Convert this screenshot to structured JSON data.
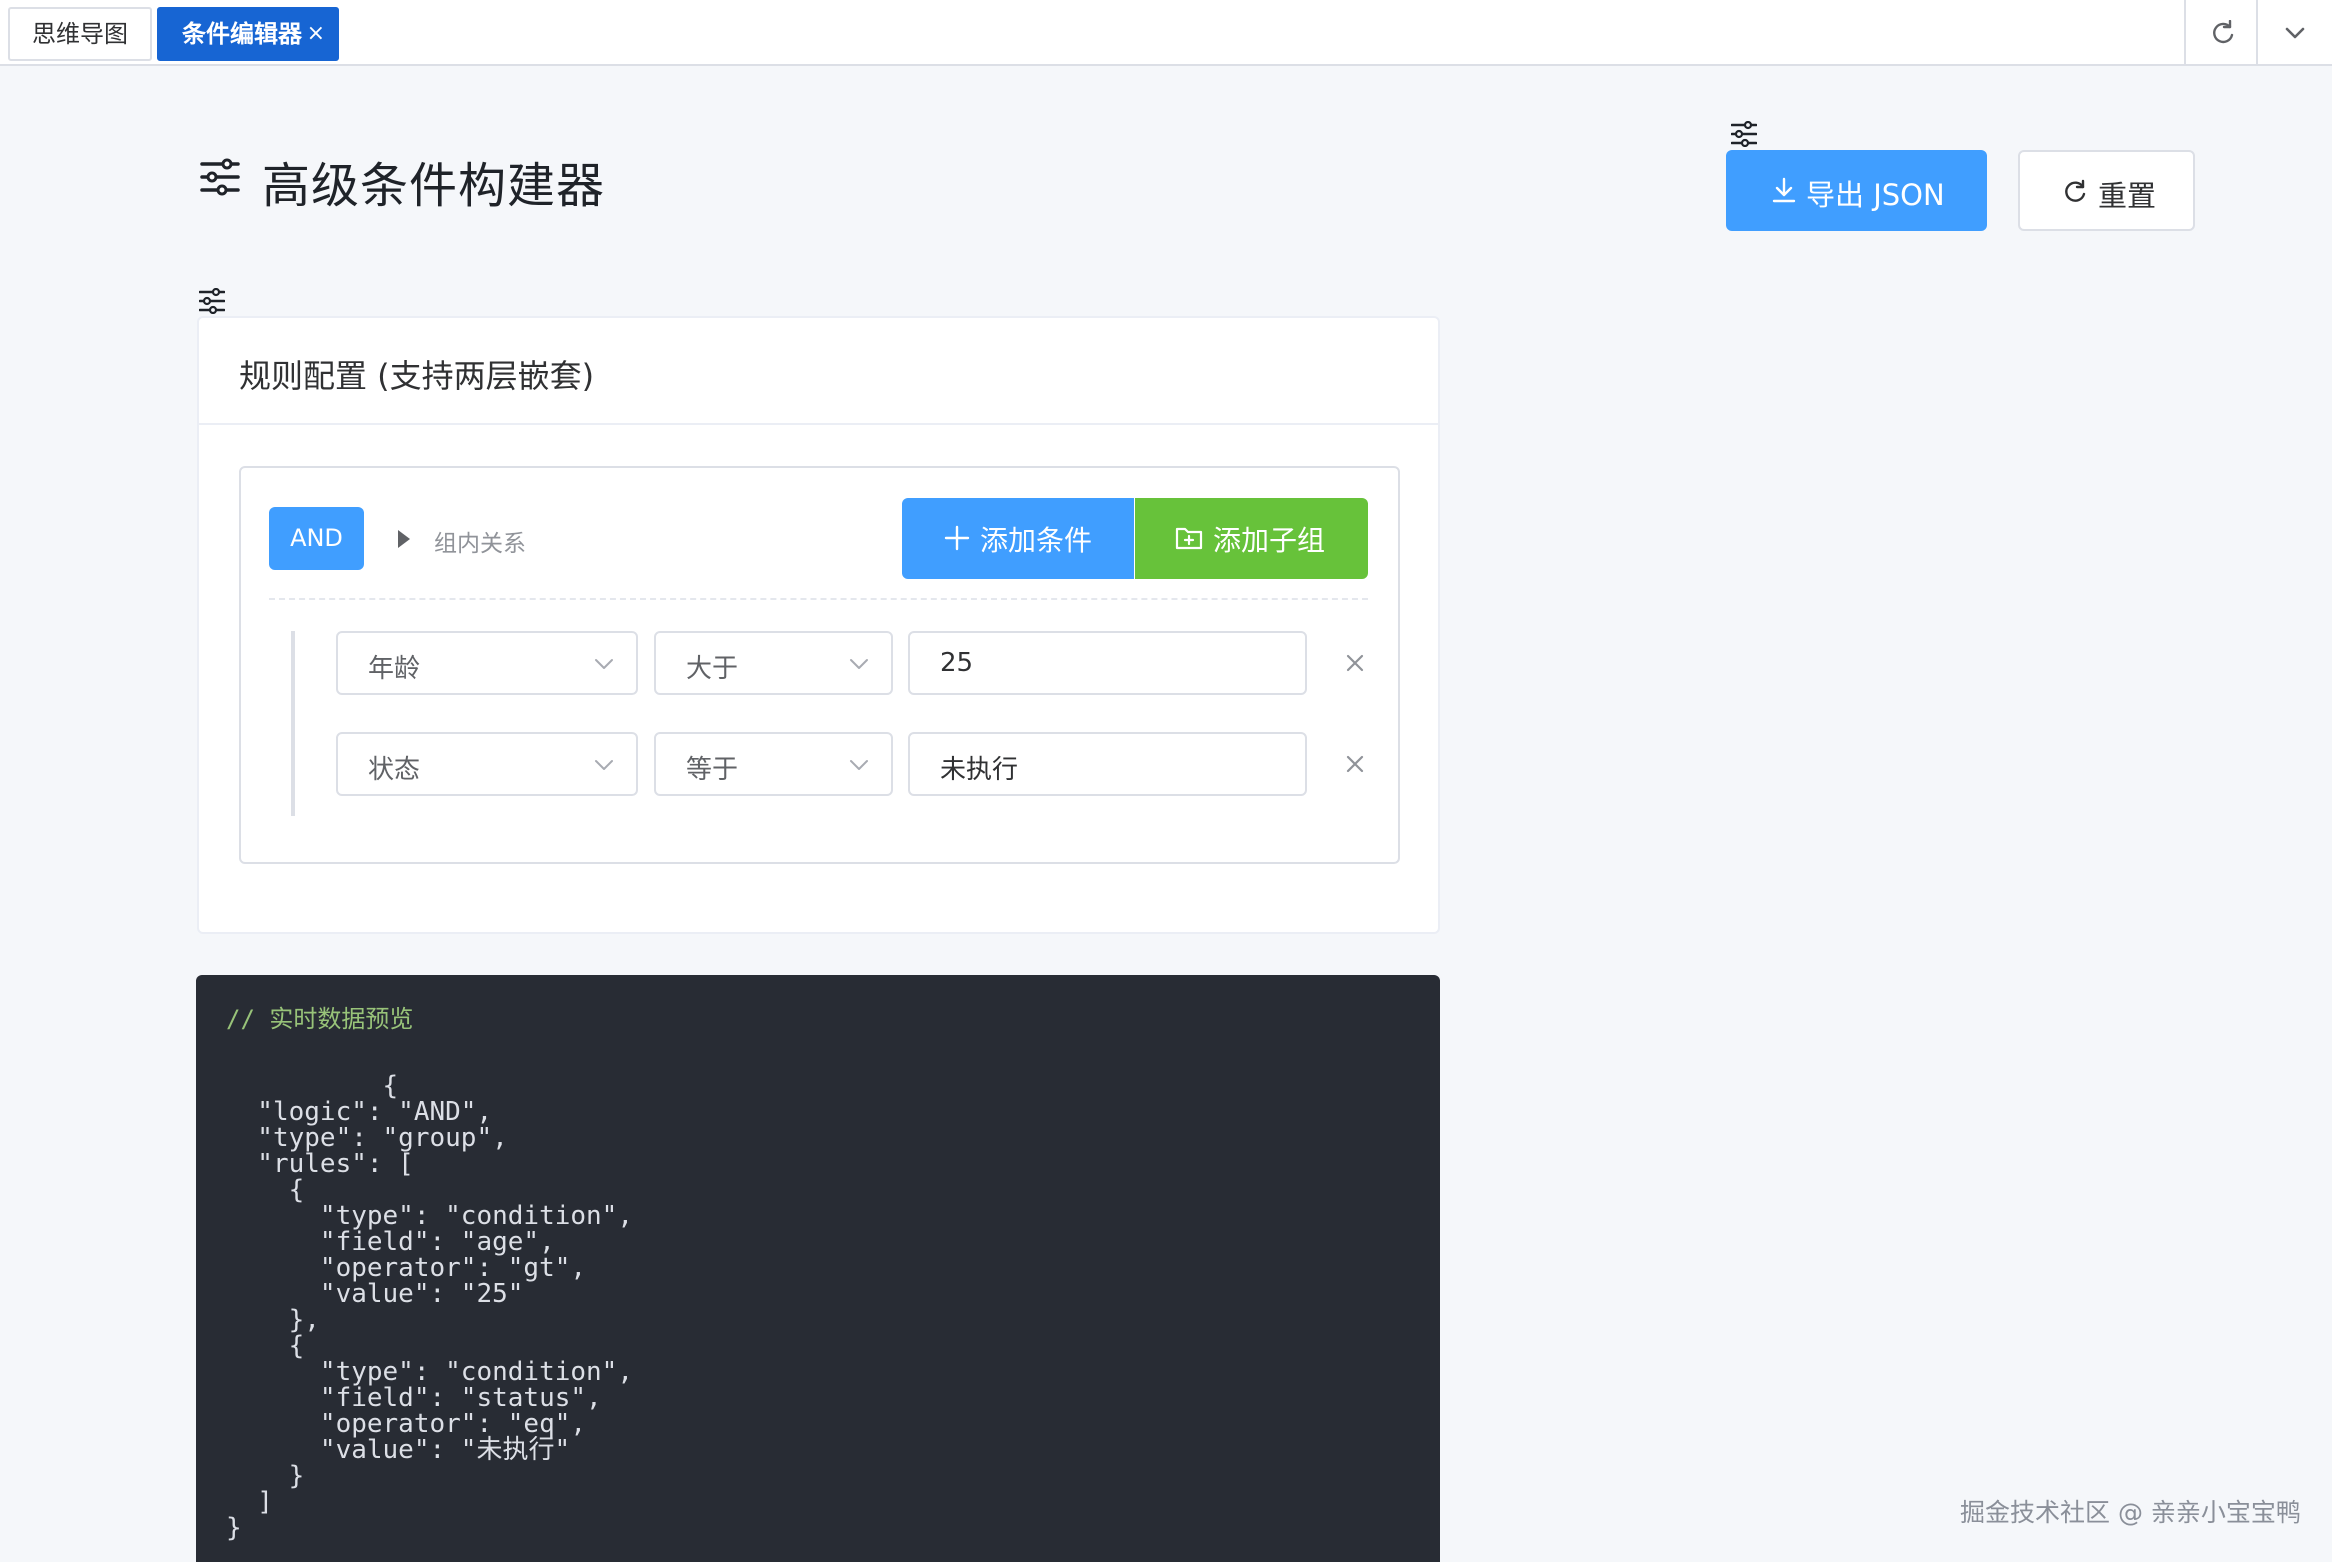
{
  "tabs": [
    {
      "label": "思维导图",
      "active": false
    },
    {
      "label": "条件编辑器",
      "active": true,
      "close": "×"
    }
  ],
  "toolbar_icons": [
    "refresh-icon",
    "chevron-down-icon"
  ],
  "header": {
    "title": "高级条件构建器",
    "title_icon": "sliders-icon",
    "export_label": "导出 JSON",
    "export_icon": "download-icon",
    "reset_label": "重置",
    "reset_icon": "refresh-icon"
  },
  "card": {
    "title": "规则配置 (支持两层嵌套)",
    "group": {
      "logic": "AND",
      "relation_label": "组内关系",
      "add_condition_label": "添加条件",
      "add_group_label": "添加子组",
      "rules": [
        {
          "field": "年龄",
          "operator": "大于",
          "value": "25"
        },
        {
          "field": "状态",
          "operator": "等于",
          "value": "未执行"
        }
      ]
    }
  },
  "preview": {
    "comment": "// 实时数据预览",
    "json_text": "          {\n  \"logic\": \"AND\",\n  \"type\": \"group\",\n  \"rules\": [\n    {\n      \"type\": \"condition\",\n      \"field\": \"age\",\n      \"operator\": \"gt\",\n      \"value\": \"25\"\n    },\n    {\n      \"type\": \"condition\",\n      \"field\": \"status\",\n      \"operator\": \"eq\",\n      \"value\": \"未执行\"\n    }\n  ]\n}"
  },
  "watermark": "掘金技术社区 @ 亲亲小宝宝鸭",
  "colors": {
    "primary": "#409eff",
    "success": "#67c23a",
    "active_tab": "#1765d3",
    "code_bg": "#282c34",
    "code_comment": "#98c379"
  }
}
